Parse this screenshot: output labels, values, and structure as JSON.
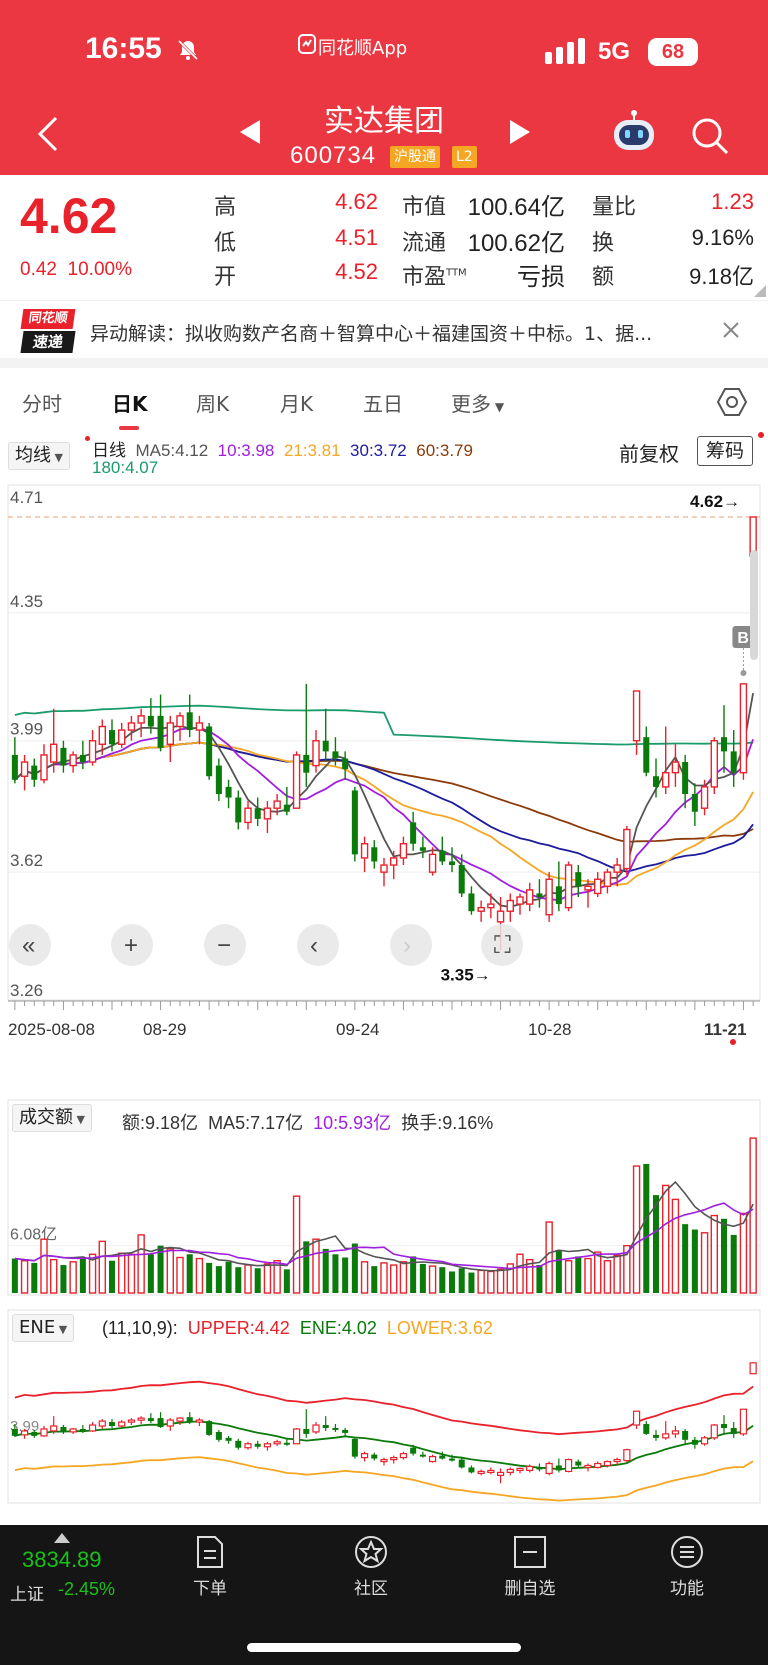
{
  "status": {
    "time": "16:55",
    "app": "同花顺App",
    "network": "5G",
    "battery": "68"
  },
  "header": {
    "title": "实达集团",
    "code": "600734",
    "tag1": "沪股通",
    "tag2": "L2"
  },
  "quote": {
    "price": "4.62",
    "change": "0.42",
    "change_pct": "10.00%",
    "high_label": "高",
    "high": "4.62",
    "low_label": "低",
    "low": "4.51",
    "open_label": "开",
    "open": "4.52",
    "mcap_label": "市值",
    "mcap": "100.64亿",
    "float_label": "流通",
    "float": "100.62亿",
    "pe_label": "市盈",
    "pe_sup": "TTM",
    "pe": "亏损",
    "vr_label": "量比",
    "vr": "1.23",
    "turn_label": "换",
    "turn": "9.16%",
    "amt_label": "额",
    "amt": "9.18亿"
  },
  "news": {
    "logo_top": "同花顺",
    "logo_bottom": "速递",
    "text": "异动解读：拟收购数产名商＋智算中心＋福建国资＋中标。1、据..."
  },
  "tabs": [
    "分时",
    "日K",
    "周K",
    "月K",
    "五日",
    "更多"
  ],
  "kline": {
    "indicator": "均线",
    "legend": {
      "name": "日线",
      "ma5": "MA5:4.12",
      "ma10": "10:3.98",
      "ma21": "21:3.81",
      "ma30": "30:3.72",
      "ma60": "60:3.79",
      "ma180": "180:4.07"
    },
    "fq": "前复权",
    "chip": "筹码",
    "marker_high": "4.62→",
    "marker_low": "3.35→",
    "b_marker": "B",
    "y_labels": [
      "4.71",
      "4.35",
      "3.99",
      "3.62",
      "3.26"
    ],
    "x_labels": [
      "2025-08-08",
      "08-29",
      "09-24",
      "10-28",
      "11-21"
    ]
  },
  "volume": {
    "indicator": "成交额",
    "amt": "额:9.18亿",
    "ma5": "MA5:7.17亿",
    "ma10": "10:5.93亿",
    "turnover": "换手:9.16%",
    "y_label": "6.08亿"
  },
  "ene": {
    "indicator": "ENE",
    "params": "(11,10,9):",
    "upper": "UPPER:4.42",
    "ene": "ENE:4.02",
    "lower": "LOWER:3.62",
    "y_label": "3.99"
  },
  "bottom": {
    "index_value": "3834.89",
    "index_name": "上证",
    "index_change": "-2.45%",
    "items": [
      "下单",
      "社区",
      "删自选",
      "功能"
    ]
  },
  "colors": {
    "up": "#e8212b",
    "down": "#0a7a0a",
    "ma5": "#555555",
    "ma10": "#a01ee0",
    "ma21": "#f5a623",
    "ma30": "#1c1c9c",
    "ma60": "#8b3a0a",
    "ma180": "#1a9b6b"
  },
  "chart_data": {
    "type": "candlestick",
    "ylim": [
      3.26,
      4.71
    ],
    "candles": [
      {
        "o": 3.95,
        "h": 4.0,
        "l": 3.87,
        "c": 3.88
      },
      {
        "o": 3.89,
        "h": 3.95,
        "l": 3.85,
        "c": 3.93
      },
      {
        "o": 3.92,
        "h": 3.94,
        "l": 3.86,
        "c": 3.88
      },
      {
        "o": 3.88,
        "h": 3.98,
        "l": 3.87,
        "c": 3.95
      },
      {
        "o": 3.93,
        "h": 4.08,
        "l": 3.9,
        "c": 3.98
      },
      {
        "o": 3.97,
        "h": 3.99,
        "l": 3.9,
        "c": 3.92
      },
      {
        "o": 3.92,
        "h": 3.96,
        "l": 3.9,
        "c": 3.95
      },
      {
        "o": 3.95,
        "h": 3.99,
        "l": 3.91,
        "c": 3.93
      },
      {
        "o": 3.93,
        "h": 4.02,
        "l": 3.92,
        "c": 3.99
      },
      {
        "o": 3.98,
        "h": 4.05,
        "l": 3.95,
        "c": 4.03
      },
      {
        "o": 4.02,
        "h": 4.05,
        "l": 3.96,
        "c": 3.98
      },
      {
        "o": 3.98,
        "h": 4.04,
        "l": 3.97,
        "c": 4.02
      },
      {
        "o": 4.02,
        "h": 4.06,
        "l": 3.99,
        "c": 4.04
      },
      {
        "o": 4.04,
        "h": 4.08,
        "l": 4.0,
        "c": 4.06
      },
      {
        "o": 4.06,
        "h": 4.11,
        "l": 4.01,
        "c": 4.03
      },
      {
        "o": 4.06,
        "h": 4.12,
        "l": 3.96,
        "c": 3.97
      },
      {
        "o": 3.98,
        "h": 4.06,
        "l": 3.93,
        "c": 4.04
      },
      {
        "o": 4.03,
        "h": 4.07,
        "l": 3.99,
        "c": 4.06
      },
      {
        "o": 4.07,
        "h": 4.12,
        "l": 4.0,
        "c": 4.02
      },
      {
        "o": 4.02,
        "h": 4.06,
        "l": 3.98,
        "c": 4.04
      },
      {
        "o": 4.03,
        "h": 4.04,
        "l": 3.88,
        "c": 3.89
      },
      {
        "o": 3.92,
        "h": 3.94,
        "l": 3.82,
        "c": 3.84
      },
      {
        "o": 3.86,
        "h": 3.88,
        "l": 3.8,
        "c": 3.83
      },
      {
        "o": 3.83,
        "h": 3.85,
        "l": 3.74,
        "c": 3.76
      },
      {
        "o": 3.76,
        "h": 3.82,
        "l": 3.74,
        "c": 3.8
      },
      {
        "o": 3.8,
        "h": 3.83,
        "l": 3.75,
        "c": 3.77
      },
      {
        "o": 3.77,
        "h": 3.82,
        "l": 3.73,
        "c": 3.8
      },
      {
        "o": 3.8,
        "h": 3.84,
        "l": 3.78,
        "c": 3.82
      },
      {
        "o": 3.81,
        "h": 3.86,
        "l": 3.78,
        "c": 3.79
      },
      {
        "o": 3.8,
        "h": 3.96,
        "l": 3.8,
        "c": 3.95
      },
      {
        "o": 3.95,
        "h": 4.15,
        "l": 3.86,
        "c": 3.9
      },
      {
        "o": 3.92,
        "h": 4.02,
        "l": 3.9,
        "c": 3.99
      },
      {
        "o": 3.99,
        "h": 4.08,
        "l": 3.93,
        "c": 3.96
      },
      {
        "o": 3.96,
        "h": 4.0,
        "l": 3.92,
        "c": 3.94
      },
      {
        "o": 3.94,
        "h": 3.96,
        "l": 3.88,
        "c": 3.91
      },
      {
        "o": 3.85,
        "h": 3.86,
        "l": 3.65,
        "c": 3.67
      },
      {
        "o": 3.66,
        "h": 3.72,
        "l": 3.62,
        "c": 3.7
      },
      {
        "o": 3.69,
        "h": 3.71,
        "l": 3.63,
        "c": 3.65
      },
      {
        "o": 3.62,
        "h": 3.66,
        "l": 3.58,
        "c": 3.64
      },
      {
        "o": 3.64,
        "h": 3.68,
        "l": 3.6,
        "c": 3.66
      },
      {
        "o": 3.66,
        "h": 3.72,
        "l": 3.64,
        "c": 3.7
      },
      {
        "o": 3.76,
        "h": 3.79,
        "l": 3.68,
        "c": 3.7
      },
      {
        "o": 3.69,
        "h": 3.72,
        "l": 3.66,
        "c": 3.68
      },
      {
        "o": 3.62,
        "h": 3.69,
        "l": 3.61,
        "c": 3.67
      },
      {
        "o": 3.68,
        "h": 3.72,
        "l": 3.64,
        "c": 3.65
      },
      {
        "o": 3.65,
        "h": 3.69,
        "l": 3.62,
        "c": 3.64
      },
      {
        "o": 3.64,
        "h": 3.67,
        "l": 3.55,
        "c": 3.56
      },
      {
        "o": 3.56,
        "h": 3.58,
        "l": 3.5,
        "c": 3.51
      },
      {
        "o": 3.51,
        "h": 3.54,
        "l": 3.48,
        "c": 3.52
      },
      {
        "o": 3.52,
        "h": 3.56,
        "l": 3.49,
        "c": 3.53
      },
      {
        "o": 3.48,
        "h": 3.55,
        "l": 3.4,
        "c": 3.51
      },
      {
        "o": 3.51,
        "h": 3.56,
        "l": 3.48,
        "c": 3.54
      },
      {
        "o": 3.53,
        "h": 3.56,
        "l": 3.5,
        "c": 3.55
      },
      {
        "o": 3.53,
        "h": 3.59,
        "l": 3.51,
        "c": 3.57
      },
      {
        "o": 3.56,
        "h": 3.6,
        "l": 3.52,
        "c": 3.55
      },
      {
        "o": 3.5,
        "h": 3.62,
        "l": 3.48,
        "c": 3.6
      },
      {
        "o": 3.58,
        "h": 3.65,
        "l": 3.51,
        "c": 3.53
      },
      {
        "o": 3.52,
        "h": 3.65,
        "l": 3.51,
        "c": 3.64
      },
      {
        "o": 3.62,
        "h": 3.64,
        "l": 3.55,
        "c": 3.58
      },
      {
        "o": 3.57,
        "h": 3.6,
        "l": 3.52,
        "c": 3.58
      },
      {
        "o": 3.56,
        "h": 3.62,
        "l": 3.55,
        "c": 3.6
      },
      {
        "o": 3.58,
        "h": 3.63,
        "l": 3.56,
        "c": 3.62
      },
      {
        "o": 3.62,
        "h": 3.66,
        "l": 3.58,
        "c": 3.64
      },
      {
        "o": 3.63,
        "h": 3.75,
        "l": 3.61,
        "c": 3.74
      },
      {
        "o": 3.99,
        "h": 4.13,
        "l": 3.95,
        "c": 4.13
      },
      {
        "o": 4.0,
        "h": 4.03,
        "l": 3.89,
        "c": 3.9
      },
      {
        "o": 3.89,
        "h": 3.94,
        "l": 3.83,
        "c": 3.86
      },
      {
        "o": 3.86,
        "h": 4.03,
        "l": 3.84,
        "c": 3.9
      },
      {
        "o": 3.9,
        "h": 3.98,
        "l": 3.86,
        "c": 3.93
      },
      {
        "o": 3.93,
        "h": 3.95,
        "l": 3.8,
        "c": 3.84
      },
      {
        "o": 3.84,
        "h": 3.87,
        "l": 3.75,
        "c": 3.79
      },
      {
        "o": 3.8,
        "h": 3.88,
        "l": 3.78,
        "c": 3.86
      },
      {
        "o": 3.86,
        "h": 4.0,
        "l": 3.84,
        "c": 3.99
      },
      {
        "o": 4.0,
        "h": 4.09,
        "l": 3.9,
        "c": 3.96
      },
      {
        "o": 3.96,
        "h": 4.02,
        "l": 3.86,
        "c": 3.9
      },
      {
        "o": 3.9,
        "h": 4.15,
        "l": 3.88,
        "c": 4.15
      },
      {
        "o": 4.51,
        "h": 4.62,
        "l": 4.51,
        "c": 4.62
      }
    ],
    "volume": [
      3.2,
      3.0,
      2.8,
      5.0,
      3.1,
      2.6,
      2.9,
      3.2,
      3.6,
      4.8,
      3.0,
      3.7,
      3.6,
      5.4,
      3.6,
      4.4,
      4.1,
      3.3,
      3.6,
      3.2,
      2.8,
      2.5,
      2.9,
      2.4,
      2.6,
      2.3,
      2.7,
      3.0,
      2.2,
      9.0,
      4.8,
      5.0,
      4.1,
      3.6,
      3.3,
      4.6,
      2.9,
      2.5,
      2.8,
      2.6,
      2.9,
      3.4,
      2.7,
      2.5,
      2.4,
      2.0,
      2.3,
      1.9,
      2.1,
      2.0,
      2.2,
      2.7,
      3.6,
      3.1,
      2.6,
      6.6,
      4.0,
      3.0,
      3.4,
      3.2,
      3.8,
      3.0,
      3.5,
      4.4,
      11.8,
      12.0,
      9.1,
      10.0,
      8.7,
      6.4,
      5.9,
      5.6,
      7.2,
      6.9,
      5.4,
      7.4,
      14.4
    ]
  }
}
